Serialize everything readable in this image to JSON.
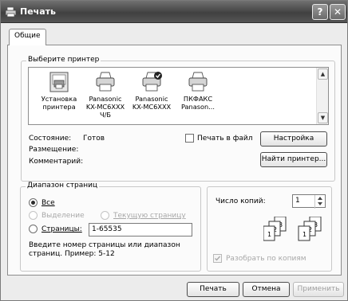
{
  "window": {
    "title": "Печать",
    "help_label": "?",
    "close_label": "✕"
  },
  "tab": {
    "general": "Общие"
  },
  "printer_group": {
    "title": "Выберите принтер",
    "printers": [
      {
        "name_lines": [
          "Установка",
          "принтера"
        ],
        "icon": "add-printer-icon"
      },
      {
        "name_lines": [
          "Panasonic",
          "KX-MC6XXX",
          "Ч/Б"
        ],
        "icon": "printer-icon"
      },
      {
        "name_lines": [
          "Panasonic",
          "KX-MC6XXX"
        ],
        "icon": "default-printer-icon"
      },
      {
        "name_lines": [
          "ПКФАКС",
          "Panason..."
        ],
        "icon": "printer-icon"
      }
    ],
    "status_label": "Состояние:",
    "status_value": "Готов",
    "location_label": "Размещение:",
    "comment_label": "Комментарий:",
    "print_to_file": "Печать в файл",
    "settings_button": "Настройка",
    "find_printer_button": "Найти принтер..."
  },
  "range_group": {
    "title": "Диапазон страниц",
    "all": "Все",
    "selection": "Выделение",
    "current_page": "Текущую страницу",
    "pages": "Страницы:",
    "pages_value": "1-65535",
    "hint": "Введите номер страницы или диапазон страниц.  Пример: 5-12"
  },
  "copies": {
    "label": "Число копий:",
    "value": "1",
    "collate": "Разобрать по копиям"
  },
  "footer": {
    "print": "Печать",
    "cancel": "Отмена",
    "apply": "Применить"
  }
}
